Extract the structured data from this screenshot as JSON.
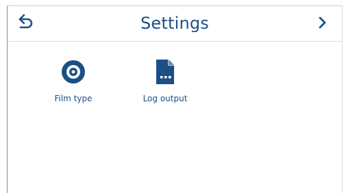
{
  "header": {
    "title": "Settings",
    "back_icon": "back-arrow-icon",
    "next_icon": "chevron-right-icon"
  },
  "tiles": [
    {
      "label": "Film type",
      "icon": "film-reel-icon"
    },
    {
      "label": "Log output",
      "icon": "log-file-icon"
    }
  ],
  "colors": {
    "accent": "#1c4f86",
    "divider": "#d7dbe4"
  }
}
